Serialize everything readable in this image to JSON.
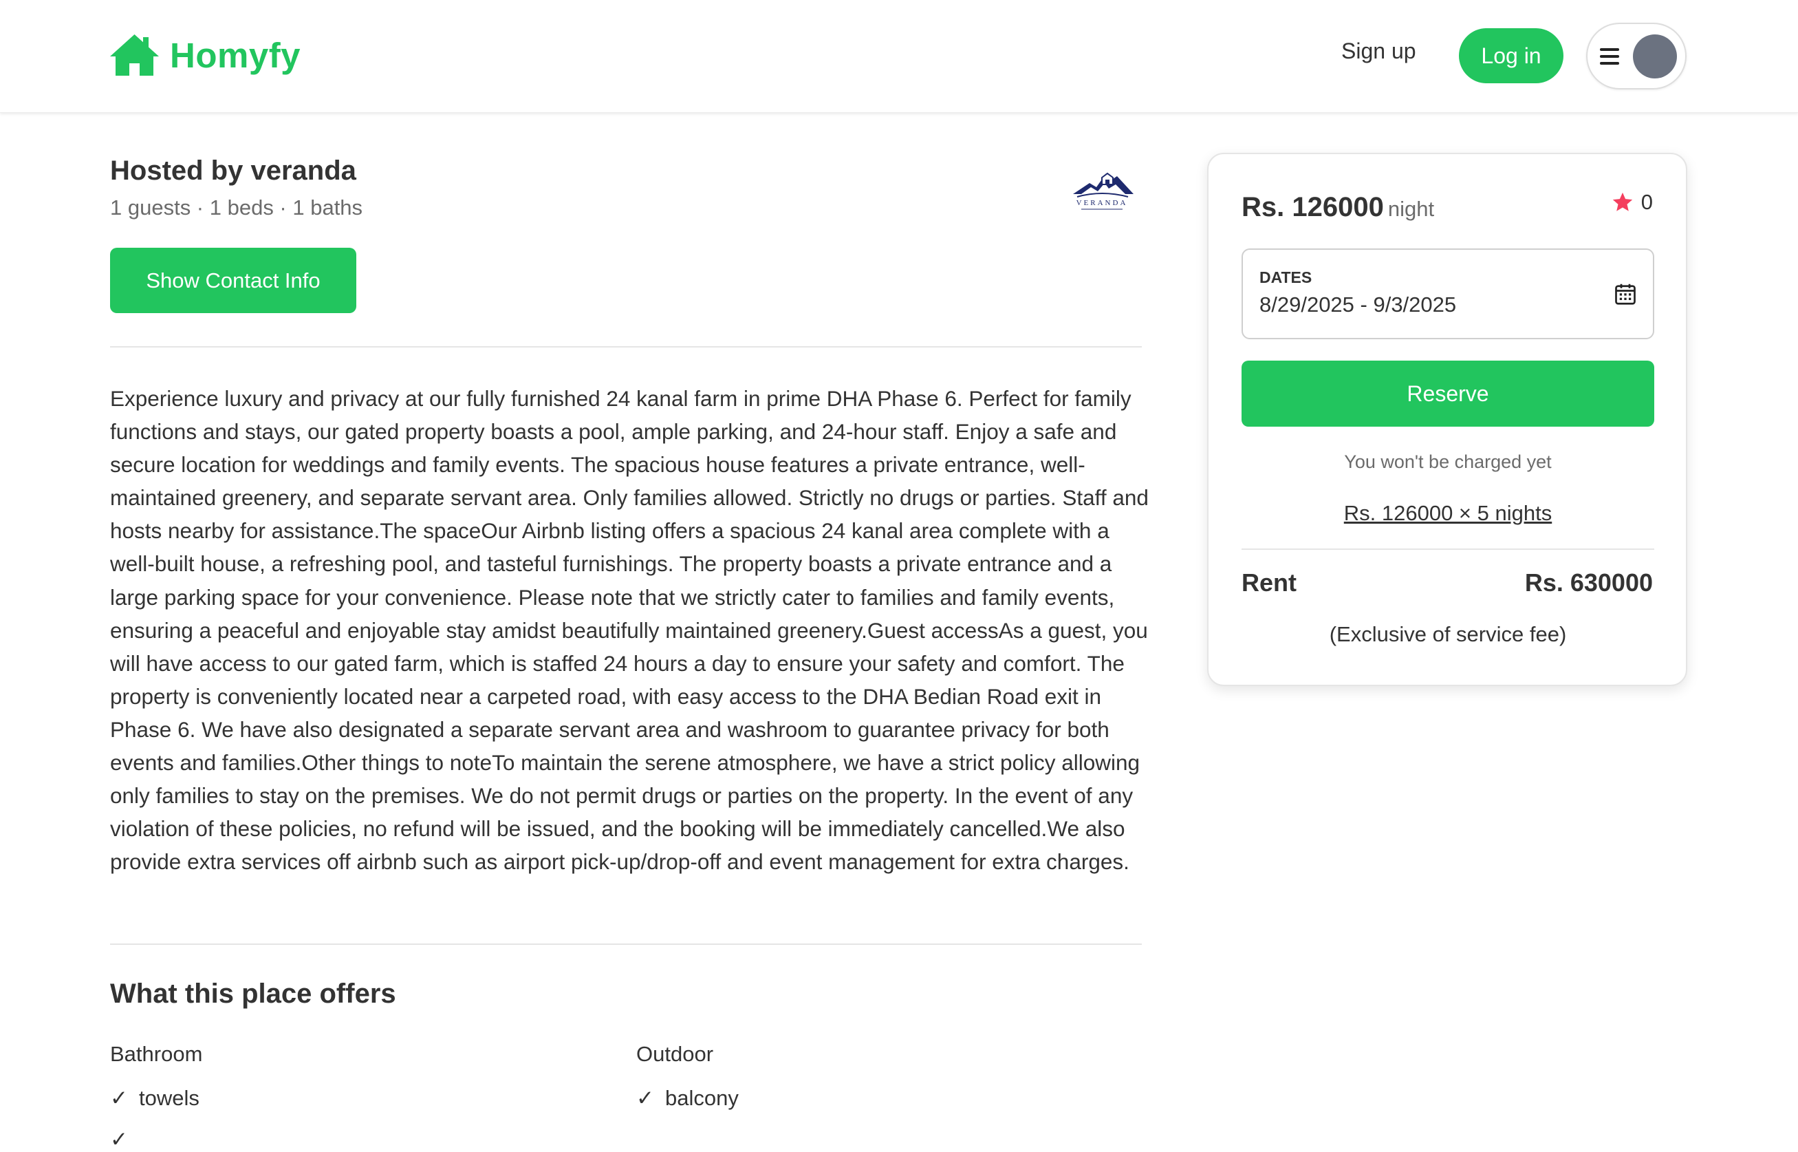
{
  "header": {
    "brand": "Homyfy",
    "signup_label": "Sign up",
    "login_label": "Log in",
    "accent_color": "#22c55e"
  },
  "host": {
    "title": "Hosted by veranda",
    "meta": "1 guests · 1 beds · 1 baths",
    "contact_button": "Show Contact Info"
  },
  "description": "Experience luxury and privacy at our fully furnished 24 kanal farm in prime DHA Phase 6. Perfect for family functions and stays, our gated property boasts a pool, ample parking, and 24-hour staff. Enjoy a safe and secure location for weddings and family events. The spacious house features a private entrance, well-maintained greenery, and separate servant area. Only families allowed. Strictly no drugs or parties. Staff and hosts nearby for assistance.The spaceOur Airbnb listing offers a spacious 24 kanal area complete with a well-built house, a refreshing pool, and tasteful furnishings. The property boasts a private entrance and a large parking space for your convenience. Please note that we strictly cater to families and family events, ensuring a peaceful and enjoyable stay amidst beautifully maintained greenery.Guest accessAs a guest, you will have access to our gated farm, which is staffed 24 hours a day to ensure your safety and comfort. The property is conveniently located near a carpeted road, with easy access to the DHA Bedian Road exit in Phase 6. We have also designated a separate servant area and washroom to guarantee privacy for both events and families.Other things to noteTo maintain the serene atmosphere, we have a strict policy allowing only families to stay on the premises. We do not permit drugs or parties on the property. In the event of any violation of these policies, no refund will be issued, and the booking will be immediately cancelled.We also provide extra services off airbnb such as airport pick-up/drop-off and event management for extra charges.",
  "offers": {
    "title": "What this place offers",
    "categories": [
      {
        "name": "Bathroom",
        "items": [
          "towels"
        ]
      },
      {
        "name": "Outdoor",
        "items": [
          "balcony"
        ]
      }
    ]
  },
  "booking": {
    "price": "Rs. 126000",
    "price_unit": "night",
    "rating": "0",
    "star_color": "#f43f5e",
    "dates_label": "DATES",
    "dates_value": "8/29/2025 - 9/3/2025",
    "reserve_label": "Reserve",
    "no_charge_note": "You won't be charged yet",
    "breakdown": "Rs. 126000 × 5 nights",
    "rent_label": "Rent",
    "rent_value": "Rs. 630000",
    "fee_note": "(Exclusive of service fee)"
  }
}
